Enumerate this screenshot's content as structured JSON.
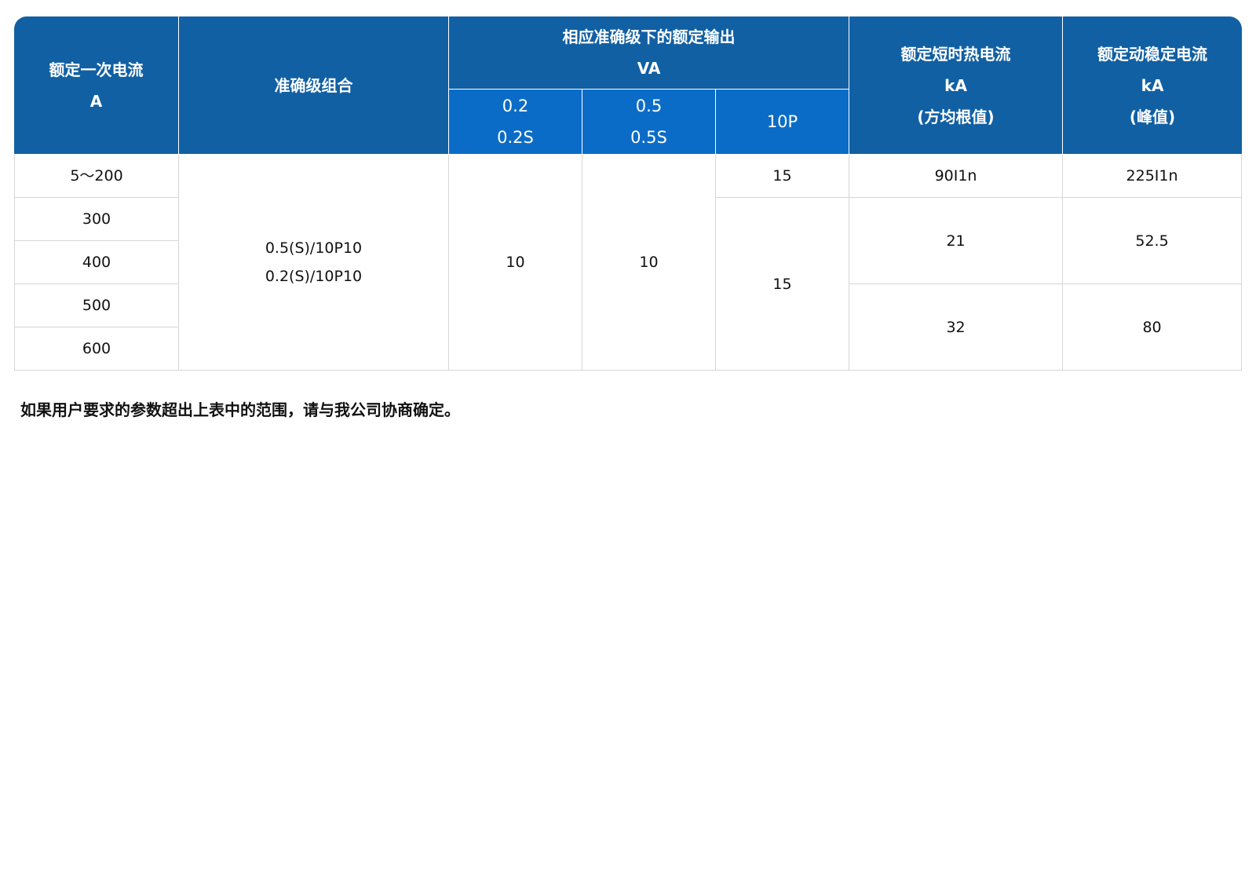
{
  "table": {
    "headers": {
      "rated_primary_current": [
        "额定一次电流",
        "A"
      ],
      "accuracy_combination": "准确级组合",
      "rated_output": [
        "相应准确级下的额定输出",
        "VA"
      ],
      "short_time_thermal": [
        "额定短时热电流",
        "kA",
        "(方均根值)"
      ],
      "dynamic_stable": [
        "额定动稳定电流",
        "kA",
        "(峰值)"
      ],
      "sub_02": [
        "0.2",
        "0.2S"
      ],
      "sub_05": [
        "0.5",
        "0.5S"
      ],
      "sub_10p": "10P"
    },
    "currents": [
      "5～200",
      "300",
      "400",
      "500",
      "600"
    ],
    "accuracy_combination": [
      "0.5(S)/10P10",
      "0.2(S)/10P10"
    ],
    "output_02": "10",
    "output_05": "10",
    "output_10p": [
      "15",
      "15"
    ],
    "thermal": [
      "90I1n",
      "21",
      "32"
    ],
    "dynamic": [
      "225I1n",
      "52.5",
      "80"
    ]
  },
  "note": "如果用户要求的参数超出上表中的范围，请与我公司协商确定。"
}
